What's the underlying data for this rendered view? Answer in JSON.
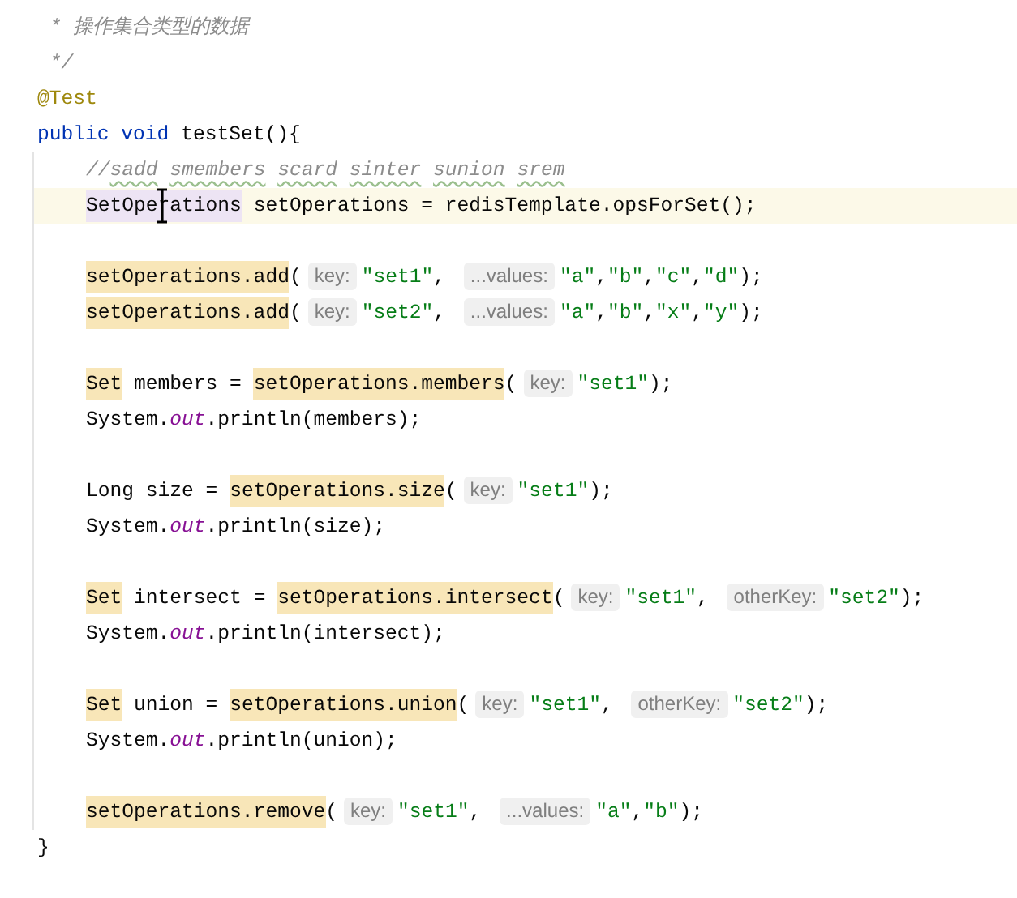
{
  "doc_comment": [
    {
      "text": " * 操作集合类型的数据"
    },
    {
      "text": " */"
    }
  ],
  "annotation": "@Test",
  "method": {
    "signature": [
      {
        "kind": "keyword",
        "text": "public void "
      },
      {
        "kind": "plain",
        "text": "testSet(){"
      }
    ],
    "body": [
      [
        {
          "current": false,
          "tokens": [
            {
              "kind": "comment",
              "typo": false,
              "text": "//"
            },
            {
              "kind": "comment",
              "typo": true,
              "text": "sadd"
            },
            {
              "kind": "comment",
              "typo": true,
              "text": "smembers"
            },
            {
              "kind": "comment",
              "typo": true,
              "text": "scard"
            },
            {
              "kind": "comment",
              "typo": true,
              "text": "sinter"
            },
            {
              "kind": "comment",
              "typo": true,
              "text": "sunion"
            },
            {
              "kind": "comment",
              "typo": true,
              "text": "srem"
            }
          ]
        },
        {
          "current": true,
          "tokens": [
            {
              "kind": "type-usage",
              "pointer_over": true,
              "text": "SetOperations"
            },
            {
              "kind": "plain",
              "text": " setOperations = "
            },
            {
              "kind": "method",
              "text": "redisTemplate.opsForSet"
            },
            {
              "kind": "plain",
              "text": "();"
            }
          ]
        }
      ],
      [
        {
          "current": false,
          "tokens": [
            {
              "kind": "usage",
              "text": "setOperations.add"
            },
            {
              "kind": "plain",
              "text": "("
            },
            {
              "kind": "hint",
              "text": "key:"
            },
            {
              "kind": "string",
              "text": "\"set1\""
            },
            {
              "kind": "plain",
              "text": ", "
            },
            {
              "kind": "hint",
              "text": "...values:"
            },
            {
              "kind": "string",
              "text": "\"a\""
            },
            {
              "kind": "plain",
              "text": ","
            },
            {
              "kind": "string",
              "text": "\"b\""
            },
            {
              "kind": "plain",
              "text": ","
            },
            {
              "kind": "string",
              "text": "\"c\""
            },
            {
              "kind": "plain",
              "text": ","
            },
            {
              "kind": "string",
              "text": "\"d\""
            },
            {
              "kind": "plain",
              "text": ");"
            }
          ]
        },
        {
          "current": false,
          "tokens": [
            {
              "kind": "usage",
              "text": "setOperations.add"
            },
            {
              "kind": "plain",
              "text": "("
            },
            {
              "kind": "hint",
              "text": "key:"
            },
            {
              "kind": "string",
              "text": "\"set2\""
            },
            {
              "kind": "plain",
              "text": ", "
            },
            {
              "kind": "hint",
              "text": "...values:"
            },
            {
              "kind": "string",
              "text": "\"a\""
            },
            {
              "kind": "plain",
              "text": ","
            },
            {
              "kind": "string",
              "text": "\"b\""
            },
            {
              "kind": "plain",
              "text": ","
            },
            {
              "kind": "string",
              "text": "\"x\""
            },
            {
              "kind": "plain",
              "text": ","
            },
            {
              "kind": "string",
              "text": "\"y\""
            },
            {
              "kind": "plain",
              "text": ");"
            }
          ]
        }
      ],
      [
        {
          "current": false,
          "tokens": [
            {
              "kind": "usage",
              "text": "Set"
            },
            {
              "kind": "plain",
              "text": " members = "
            },
            {
              "kind": "usage",
              "text": "setOperations.members"
            },
            {
              "kind": "plain",
              "text": "("
            },
            {
              "kind": "hint",
              "text": "key:"
            },
            {
              "kind": "string",
              "text": "\"set1\""
            },
            {
              "kind": "plain",
              "text": ");"
            }
          ]
        },
        {
          "current": false,
          "tokens": [
            {
              "kind": "plain",
              "text": "System."
            },
            {
              "kind": "field",
              "text": "out"
            },
            {
              "kind": "plain",
              "text": ".println(members);"
            }
          ]
        }
      ],
      [
        {
          "current": false,
          "tokens": [
            {
              "kind": "plain",
              "text": "Long size = "
            },
            {
              "kind": "usage",
              "text": "setOperations.size"
            },
            {
              "kind": "plain",
              "text": "("
            },
            {
              "kind": "hint",
              "text": "key:"
            },
            {
              "kind": "string",
              "text": "\"set1\""
            },
            {
              "kind": "plain",
              "text": ");"
            }
          ]
        },
        {
          "current": false,
          "tokens": [
            {
              "kind": "plain",
              "text": "System."
            },
            {
              "kind": "field",
              "text": "out"
            },
            {
              "kind": "plain",
              "text": ".println(size);"
            }
          ]
        }
      ],
      [
        {
          "current": false,
          "tokens": [
            {
              "kind": "usage",
              "text": "Set"
            },
            {
              "kind": "plain",
              "text": " intersect = "
            },
            {
              "kind": "usage",
              "text": "setOperations.intersect"
            },
            {
              "kind": "plain",
              "text": "("
            },
            {
              "kind": "hint",
              "text": "key:"
            },
            {
              "kind": "string",
              "text": "\"set1\""
            },
            {
              "kind": "plain",
              "text": ", "
            },
            {
              "kind": "hint",
              "text": "otherKey:"
            },
            {
              "kind": "string",
              "text": "\"set2\""
            },
            {
              "kind": "plain",
              "text": ");"
            }
          ]
        },
        {
          "current": false,
          "tokens": [
            {
              "kind": "plain",
              "text": "System."
            },
            {
              "kind": "field",
              "text": "out"
            },
            {
              "kind": "plain",
              "text": ".println(intersect);"
            }
          ]
        }
      ],
      [
        {
          "current": false,
          "tokens": [
            {
              "kind": "usage",
              "text": "Set"
            },
            {
              "kind": "plain",
              "text": " union = "
            },
            {
              "kind": "usage",
              "text": "setOperations.union"
            },
            {
              "kind": "plain",
              "text": "("
            },
            {
              "kind": "hint",
              "text": "key:"
            },
            {
              "kind": "string",
              "text": "\"set1\""
            },
            {
              "kind": "plain",
              "text": ", "
            },
            {
              "kind": "hint",
              "text": "otherKey:"
            },
            {
              "kind": "string",
              "text": "\"set2\""
            },
            {
              "kind": "plain",
              "text": ");"
            }
          ]
        },
        {
          "current": false,
          "tokens": [
            {
              "kind": "plain",
              "text": "System."
            },
            {
              "kind": "field",
              "text": "out"
            },
            {
              "kind": "plain",
              "text": ".println(union);"
            }
          ]
        }
      ],
      [
        {
          "current": false,
          "tokens": [
            {
              "kind": "usage",
              "text": "setOperations.remove"
            },
            {
              "kind": "plain",
              "text": "("
            },
            {
              "kind": "hint",
              "text": "key:"
            },
            {
              "kind": "string",
              "text": "\"set1\""
            },
            {
              "kind": "plain",
              "text": ", "
            },
            {
              "kind": "hint",
              "text": "...values:"
            },
            {
              "kind": "string",
              "text": "\"a\""
            },
            {
              "kind": "plain",
              "text": ","
            },
            {
              "kind": "string",
              "text": "\"b\""
            },
            {
              "kind": "plain",
              "text": ");"
            }
          ]
        }
      ]
    ],
    "close": "}"
  }
}
